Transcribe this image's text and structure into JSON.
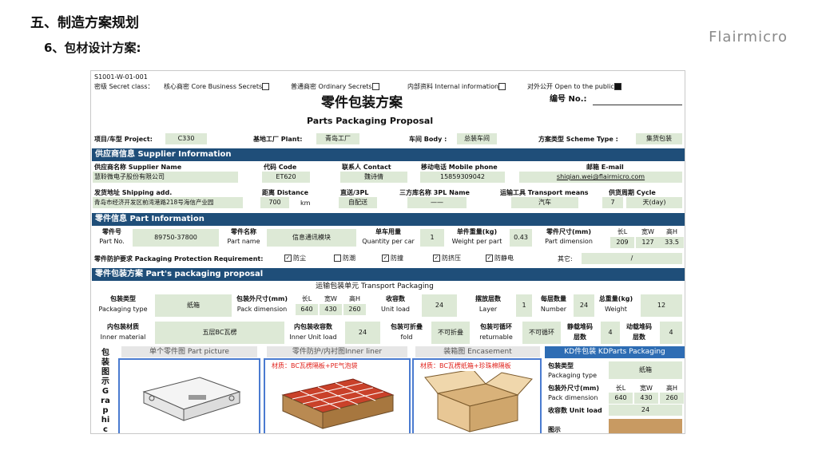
{
  "slide": {
    "title": "五、制造方案规划",
    "subtitle": "6、包材设计方案:",
    "brand": "Flairmicro"
  },
  "sheet": {
    "doc_code": "S1001-W-01-001",
    "secret_line": {
      "label": "密级 Secret class：",
      "core": "核心商密 Core Business Secrets",
      "ordinary": "普通商密 Ordinary Secrets",
      "internal": "内部资料 Internal information",
      "public": "对外公开 Open to the public"
    },
    "title_cn": "零件包装方案",
    "title_en": "Parts Packaging Proposal",
    "number_label": "编号 No.:",
    "project_label": "项目/车型 Project:",
    "project": "C330",
    "plant_label": "基地工厂 Plant:",
    "plant": "青岛工厂",
    "body_label": "车间 Body :",
    "body": "总装车间",
    "scheme_label": "方案类型 Scheme Type :",
    "scheme": "集货包装",
    "supplier_band": "供应商信息 Supplier Information",
    "supplier_name_label": "供应商名称 Supplier Name",
    "supplier_name": "慧聆微电子股份有限公司",
    "code_label": "代码 Code",
    "code": "ET620",
    "contact_label": "联系人 Contact",
    "contact": "魏诗倩",
    "mobile_label": "移动电话 Mobile phone",
    "mobile": "15859309042",
    "email_label": "邮箱 E-mail",
    "email": "shiqian.wei@flairmicro.com",
    "ship_label": "发货地址 Shipping add.",
    "ship_addr": "青岛市经济开发区前湾港路218号海信产业园",
    "distance_label": "距离 Distance",
    "distance": "700",
    "distance_unit": "km",
    "direct_label": "直送/3PL",
    "direct": "自配送",
    "tpl_label": "三方库名称 3PL Name",
    "tpl": "——",
    "transport_label": "运输工具 Transport means",
    "transport": "汽车",
    "cycle_label": "供货周期 Cycle",
    "cycle_num": "7",
    "cycle_unit": "天(day)",
    "part_band": "零件信息 Part Information",
    "part_no_label1": "零件号",
    "part_no_label2": "Part No.",
    "part_no": "89750-37800",
    "part_name_label1": "零件名称",
    "part_name_label2": "Part name",
    "part_name": "信息通讯模块",
    "qty_label1": "单车用量",
    "qty_label2": "Quantity per car",
    "qty": "1",
    "weight_label1": "单件重量(kg)",
    "weight_label2": "Weight per part",
    "weight": "0.43",
    "dim_label1": "零件尺寸(mm)",
    "dim_label2": "Part dimension",
    "dim_heads": [
      "长L",
      "宽W",
      "高H"
    ],
    "dim_vals": [
      "209",
      "127",
      "33.5"
    ],
    "protect_label": "零件防护要求 Packaging Protection Requirement:",
    "protect_opts": [
      {
        "label": "防尘",
        "checked": true
      },
      {
        "label": "防潮",
        "checked": false
      },
      {
        "label": "防撞",
        "checked": true
      },
      {
        "label": "防挤压",
        "checked": true
      },
      {
        "label": "防静电",
        "checked": true
      }
    ],
    "other_label": "其它:",
    "other": "/",
    "pack_band": "零件包装方案 Part's packaging proposal",
    "transport_unit": "运输包装单元 Transport Packaging",
    "pack_type_label1": "包装类型",
    "pack_type_label2": "Packaging type",
    "pack_type": "纸箱",
    "pack_dim_label1": "包装外尺寸(mm)",
    "pack_dim_label2": "Pack dimension",
    "pack_dim_heads": [
      "长L",
      "宽W",
      "高H"
    ],
    "pack_dim_vals": [
      "640",
      "430",
      "260"
    ],
    "unit_load_label1": "收容数",
    "unit_load_label2": "Unit load",
    "unit_load": "24",
    "layer_label1": "摆放层数",
    "layer_label2": "Layer",
    "layer": "1",
    "number_label1": "每层数量",
    "number_label2": "Number",
    "number": "24",
    "total_weight_label1": "总重量(kg)",
    "total_weight_label2": "Weight",
    "total_weight": "12",
    "inner_mat_label1": "内包装材质",
    "inner_mat_label2": "Inner material",
    "inner_mat": "五层BC瓦楞",
    "inner_load_label1": "内包装收容数",
    "inner_load_label2": "Inner Unit load",
    "inner_load": "24",
    "fold_label1": "包装可折叠",
    "fold_label2": "fold",
    "fold": "不可折叠",
    "returnable_label1": "包装可循环",
    "returnable_label2": "returnable",
    "returnable": "不可循环",
    "static_label1": "静载堆码",
    "static_label2": "层数",
    "static": "4",
    "dynamic_label1": "动载堆码",
    "dynamic_label2": "层数",
    "dynamic": "4",
    "graphic_label": "包装图示 Graphic expre",
    "pic_single": "单个零件图 Part picture",
    "pic_liner": "零件防护/内衬图Inner liner",
    "pic_liner_mat": "材质：BC瓦楞隔板+PE气泡袋",
    "pic_case": "装箱图 Encasement",
    "pic_case_mat": "材质：BC瓦楞纸箱+珍珠棉隔板",
    "kd_header": "KD件包装 KDParts Packaging",
    "kd_type_label1": "包装类型",
    "kd_type_label2": "Packaging type",
    "kd_type": "纸箱",
    "kd_dim_label1": "包装外尺寸(mm)",
    "kd_dim_label2": "Pack dimension",
    "kd_dim_heads": [
      "长L",
      "宽W",
      "高H"
    ],
    "kd_dim_vals": [
      "640",
      "430",
      "260"
    ],
    "kd_load_label": "收容数 Unit load",
    "kd_load": "24",
    "kd_pic_label": "图示"
  }
}
